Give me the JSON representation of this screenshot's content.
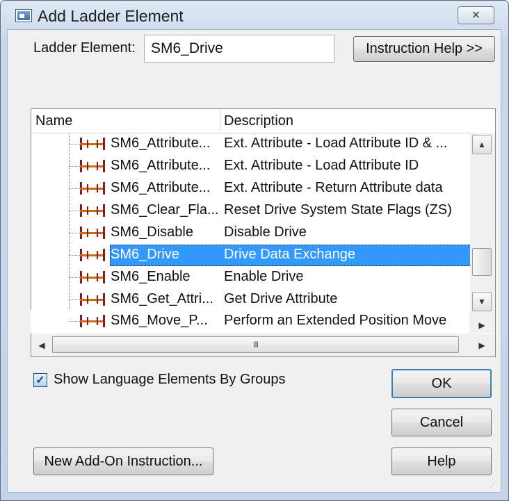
{
  "window": {
    "title": "Add Ladder Element",
    "close_icon": "✕"
  },
  "form": {
    "ladder_element_label": "Ladder Element:",
    "ladder_element_value": "SM6_Drive",
    "instruction_help_button": "Instruction Help >>"
  },
  "list": {
    "col_name": "Name",
    "col_description": "Description",
    "rows": [
      {
        "name": "SM6_Attribute...",
        "description": "Ext. Attribute - Load Attribute ID & ...",
        "selected": false
      },
      {
        "name": "SM6_Attribute...",
        "description": "Ext. Attribute - Load Attribute ID",
        "selected": false
      },
      {
        "name": "SM6_Attribute...",
        "description": "Ext. Attribute -  Return Attribute data",
        "selected": false
      },
      {
        "name": "SM6_Clear_Fla...",
        "description": "Reset Drive System State Flags (ZS)",
        "selected": false
      },
      {
        "name": "SM6_Disable",
        "description": "Disable Drive",
        "selected": false
      },
      {
        "name": "SM6_Drive",
        "description": "Drive Data Exchange",
        "selected": true
      },
      {
        "name": "SM6_Enable",
        "description": "Enable Drive",
        "selected": false
      },
      {
        "name": "SM6_Get_Attri...",
        "description": "Get Drive Attribute",
        "selected": false
      },
      {
        "name": "SM6_Move_P...",
        "description": "Perform an Extended Position Move",
        "selected": false
      }
    ],
    "hscroll_grip": "III"
  },
  "options": {
    "show_groups_label": "Show Language Elements By Groups",
    "show_groups_checked": true
  },
  "buttons": {
    "ok": "OK",
    "cancel": "Cancel",
    "help": "Help",
    "new_aoi": "New Add-On Instruction..."
  },
  "colors": {
    "selection": "#3399ff",
    "dialog_bg": "#f0f0f0",
    "rung_rail": "#8a1a12"
  }
}
